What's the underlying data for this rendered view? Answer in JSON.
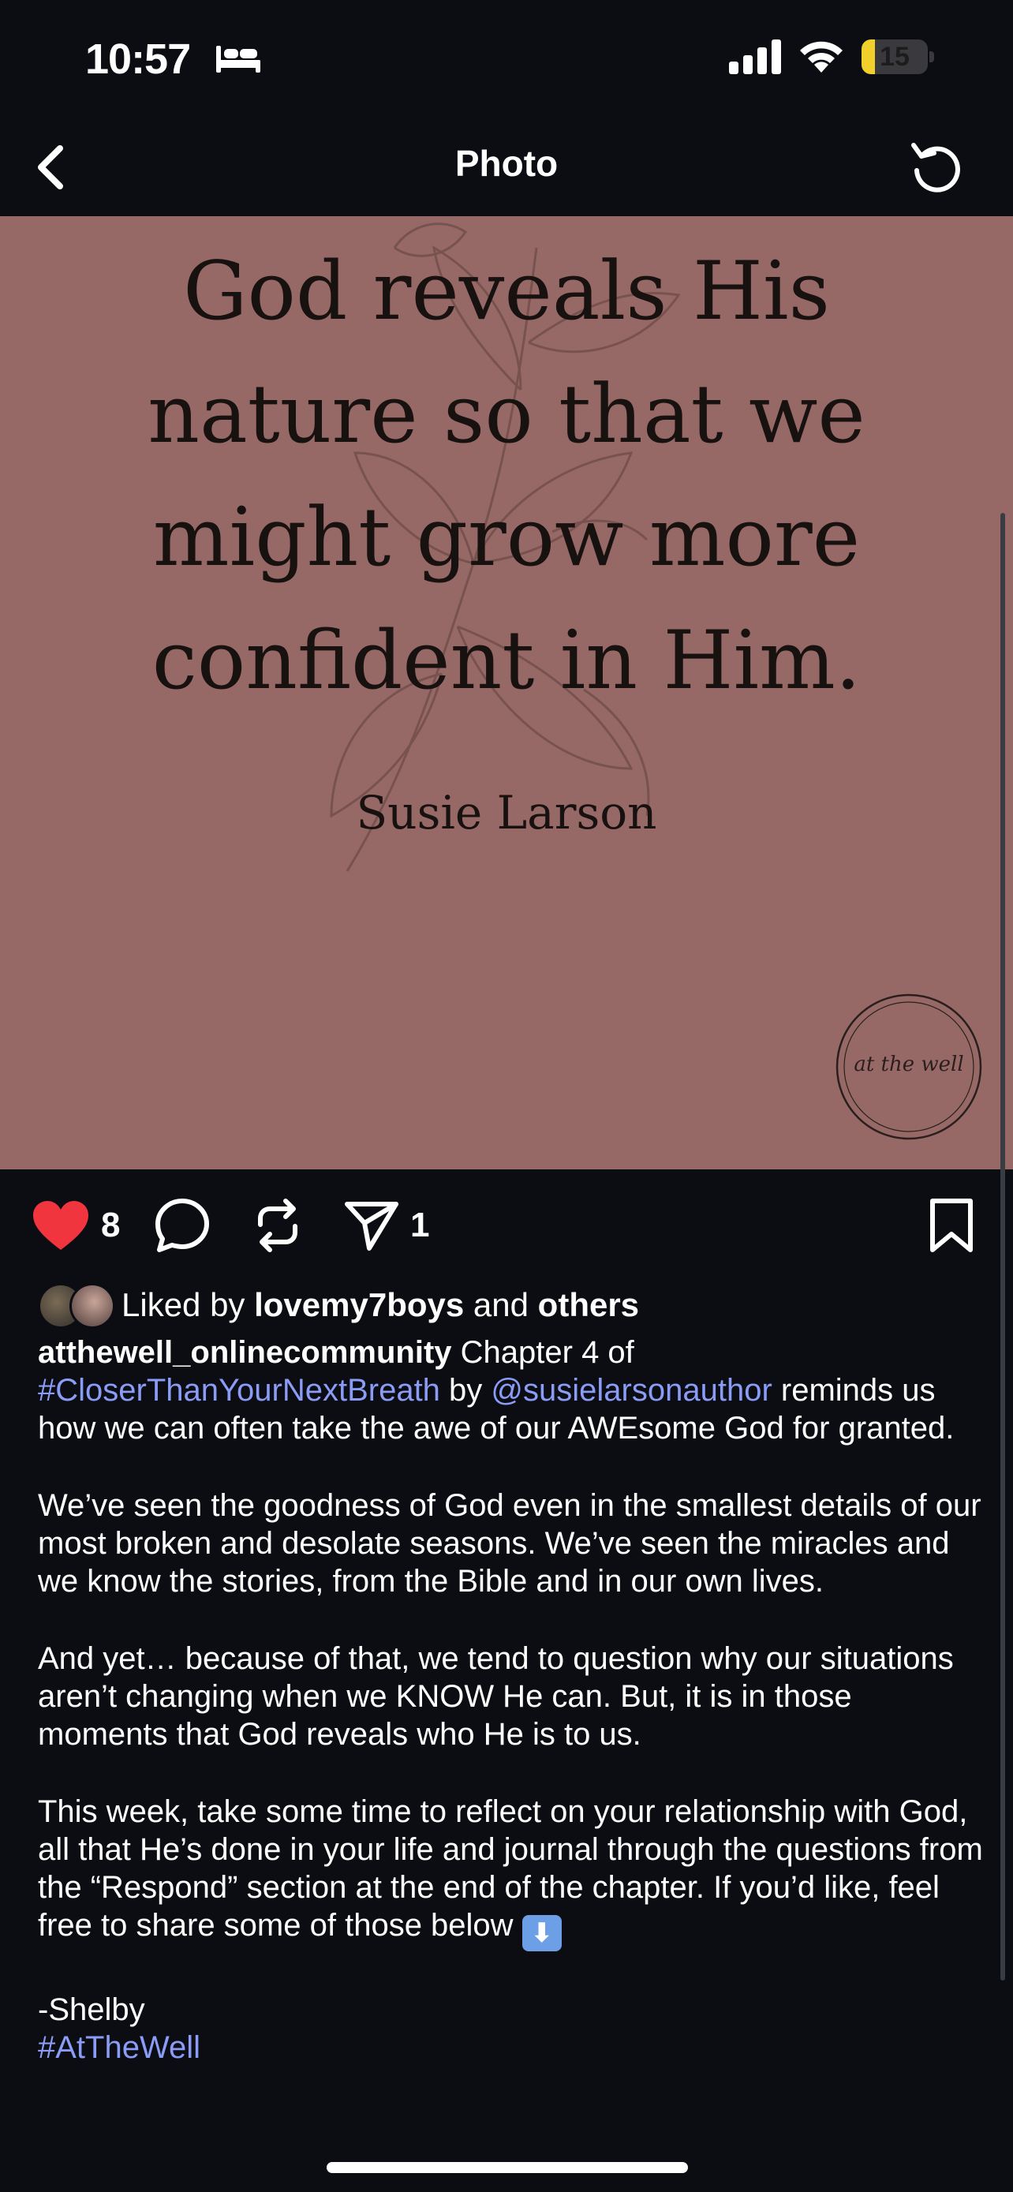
{
  "status_bar": {
    "time": "10:57",
    "battery_level": "15",
    "battery_fraction": 0.15
  },
  "nav": {
    "title": "Photo"
  },
  "photo": {
    "quote_lines": [
      "God reveals His",
      "nature so that we",
      "might grow more",
      "confident in Him."
    ],
    "author": "Susie Larson",
    "watermark": "at the well",
    "background_color": "#976966"
  },
  "actions": {
    "like_count": "8",
    "share_count": "1",
    "heart_color": "#f0353f"
  },
  "liked_by": {
    "prefix": "Liked by",
    "user": "lovemy7boys",
    "and": "and",
    "others": "others"
  },
  "post": {
    "username": "atthewell_onlinecommunity",
    "intro": "Chapter 4 of",
    "hashtag_book": "#CloserThanYourNextBreath",
    "by": "by",
    "mention": "@susielarsonauthor",
    "line1_rest": "reminds us how we can often take the awe of our AWEsome God for granted.",
    "para2": "We’ve seen the goodness of God even in the smallest details of our most broken and desolate seasons. We’ve seen the miracles and we know the stories, from the Bible and in our own lives.",
    "para3": "And yet… because of that, we tend to question why our situations aren’t changing when we KNOW He can. But, it is in those moments that God reveals who He is to us.",
    "para4": "This week, take some time to reflect on your relationship with God, all that He’s done in your life and journal through the questions from the “Respond” section at the end of the chapter. If you’d like, feel free to share some of those below",
    "para4_emoji": "⬇",
    "signature": "-Shelby",
    "hashtag_end": "#AtTheWell",
    "link_color": "#8a9cf5"
  }
}
